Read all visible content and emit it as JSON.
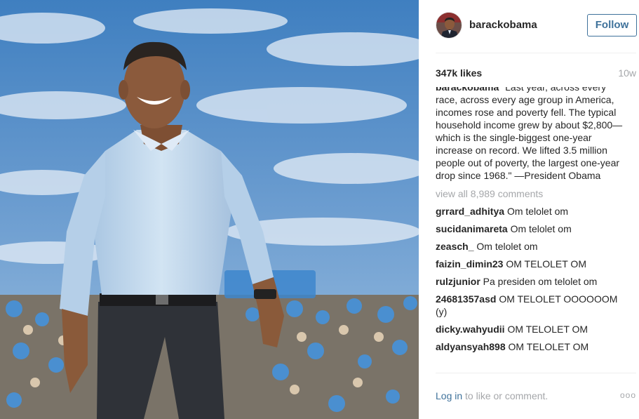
{
  "post": {
    "username": "barackobama",
    "follow_label": "Follow",
    "likes": "347k likes",
    "age": "10w",
    "caption_user": "barackobama",
    "caption_text": "\"Last year, across every race, across every age group in America, incomes rose and poverty fell. The typical household income grew by about $2,800—which is the single-biggest one-year increase on record. We lifted 3.5 million people out of poverty, the largest one-year drop since 1968.\" —President Obama",
    "view_all": "view all 8,989 comments"
  },
  "comments": [
    {
      "user": "grrard_adhitya",
      "text": "Om telolet om"
    },
    {
      "user": "sucidanimareta",
      "text": "Om telolet om"
    },
    {
      "user": "zeasch_",
      "text": "Om telolet om"
    },
    {
      "user": "faizin_dimin23",
      "text": "OM TELOLET OM"
    },
    {
      "user": "rulzjunior",
      "text": "Pa presiden om telolet om"
    },
    {
      "user": "24681357asd",
      "text": "OM TELOLET OOOOOOM (y)"
    },
    {
      "user": "dicky.wahyudii",
      "text": "OM TELOLET OM"
    },
    {
      "user": "aldyansyah898",
      "text": "OM TELOLET OM"
    }
  ],
  "footer": {
    "login_link": "Log in",
    "login_suffix": " to like or comment.",
    "more_label": "ooo"
  },
  "colors": {
    "link": "#3f729b",
    "muted": "#a5a7aa",
    "text": "#262626",
    "divider": "#efefef"
  },
  "icons": {
    "more": "more-options-icon"
  }
}
